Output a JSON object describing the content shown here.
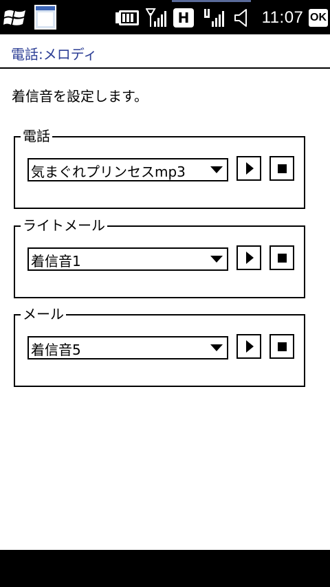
{
  "status": {
    "clock": "11:07",
    "ok_label": "OK",
    "network_label": "H",
    "icons": [
      "windows-start-icon",
      "task-window-icon",
      "battery-icon",
      "signal-icon",
      "hsdpa-icon",
      "signal-icon",
      "volume-icon"
    ]
  },
  "page": {
    "title": "電話:メロディ",
    "instruction": "着信音を設定します。"
  },
  "groups": [
    {
      "label": "電話",
      "selected": "気まぐれプリンセスmp3"
    },
    {
      "label": "ライトメール",
      "selected": "着信音1"
    },
    {
      "label": "メール",
      "selected": "着信音5"
    }
  ],
  "colors": {
    "title": "#2c3e95",
    "statusbar": "#000000",
    "background": "#ffffff"
  }
}
